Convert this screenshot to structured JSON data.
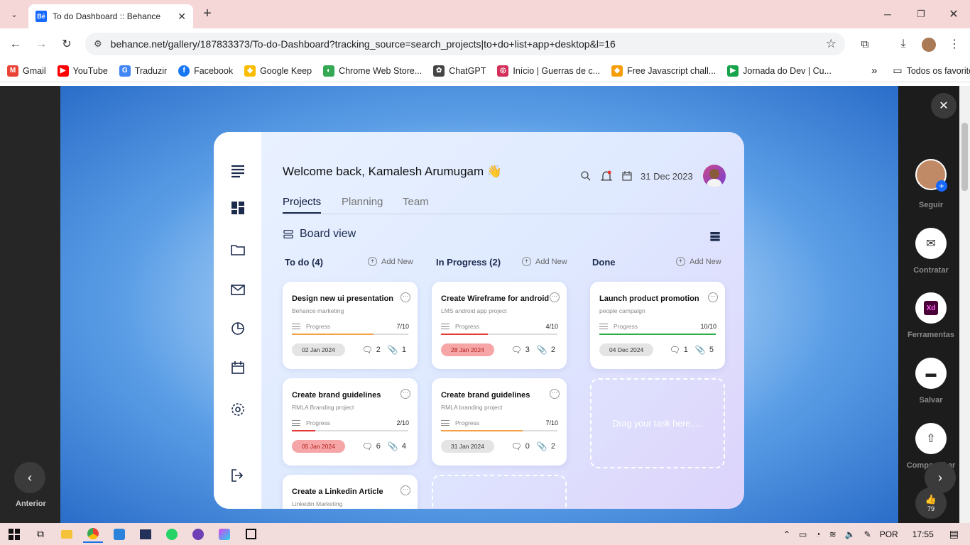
{
  "browser": {
    "tab_title": "To do Dashboard :: Behance",
    "tab_favicon": "Bē",
    "url": "behance.net/gallery/187833373/To-do-Dashboard?tracking_source=search_projects|to+do+list+app+desktop&l=16",
    "bookmarks": [
      {
        "label": "Gmail",
        "icon": "M",
        "color": "#ea4335"
      },
      {
        "label": "YouTube",
        "icon": "▶",
        "color": "#ff0000"
      },
      {
        "label": "Traduzir",
        "icon": "G",
        "color": "#4285f4"
      },
      {
        "label": "Facebook",
        "icon": "f",
        "color": "#1877f2"
      },
      {
        "label": "Google Keep",
        "icon": "◆",
        "color": "#fbbc04"
      },
      {
        "label": "Chrome Web Store...",
        "icon": "◐",
        "color": "#34a853"
      },
      {
        "label": "ChatGPT",
        "icon": "✿",
        "color": "#444444"
      },
      {
        "label": "Início | Guerras de c...",
        "icon": "◎",
        "color": "#d32f5a"
      },
      {
        "label": "Free Javascript chall...",
        "icon": "◆",
        "color": "#f59e0b"
      },
      {
        "label": "Jornada do Dev | Cu...",
        "icon": "▶",
        "color": "#16a34a"
      }
    ],
    "all_bookmarks": "Todos os favoritos"
  },
  "dashboard": {
    "welcome": "Welcome back, Kamalesh Arumugam 👋",
    "date": "31 Dec 2023",
    "tabs": [
      "Projects",
      "Planning",
      "Team"
    ],
    "board_view": "Board view",
    "add_new": "Add New",
    "progress_label": "Progress",
    "drag_text": "Drag your task here.....",
    "columns": [
      {
        "title": "To do (4)"
      },
      {
        "title": "In Progress (2)"
      },
      {
        "title": "Done"
      }
    ],
    "cards": [
      {
        "title": "Design new ui presentation",
        "subtitle": "Behance marketing",
        "progress": "7/10",
        "fraction": 0.7,
        "bar_color": "#f4a14a",
        "date": "02 Jan 2024",
        "date_red": false,
        "comments": "2",
        "attachments": "1"
      },
      {
        "title": "Create brand guidelines",
        "subtitle": "RMLA Branding project",
        "progress": "2/10",
        "fraction": 0.2,
        "bar_color": "#e53935",
        "date": "05 Jan 2024",
        "date_red": true,
        "comments": "6",
        "attachments": "4"
      },
      {
        "title": "Create a Linkedin Article",
        "subtitle": "Linkedin Marketing"
      },
      {
        "title": "Create Wireframe for android",
        "subtitle": "LMS android app project",
        "progress": "4/10",
        "fraction": 0.4,
        "bar_color": "#e53935",
        "date": "28 Jan 2024",
        "date_red": true,
        "comments": "3",
        "attachments": "2"
      },
      {
        "title": "Create brand guidelines",
        "subtitle": "RMLA branding project",
        "progress": "7/10",
        "fraction": 0.7,
        "bar_color": "#f4a14a",
        "date": "31 Jan 2024",
        "date_red": false,
        "comments": "0",
        "attachments": "2"
      },
      {
        "title": "Launch product promotion",
        "subtitle": "people campaign",
        "progress": "10/10",
        "fraction": 1.0,
        "bar_color": "#2eae4a",
        "date": "04 Dec 2024",
        "date_red": false,
        "comments": "1",
        "attachments": "5"
      }
    ]
  },
  "behance_actions": {
    "follow": "Seguir",
    "hire": "Contratar",
    "tools": "Ferramentas",
    "tools_icon": "Xd",
    "save": "Salvar",
    "share": "Compartilhar",
    "likes": "79",
    "previous": "Anterior"
  },
  "taskbar": {
    "language": "POR",
    "time": "17:55"
  }
}
